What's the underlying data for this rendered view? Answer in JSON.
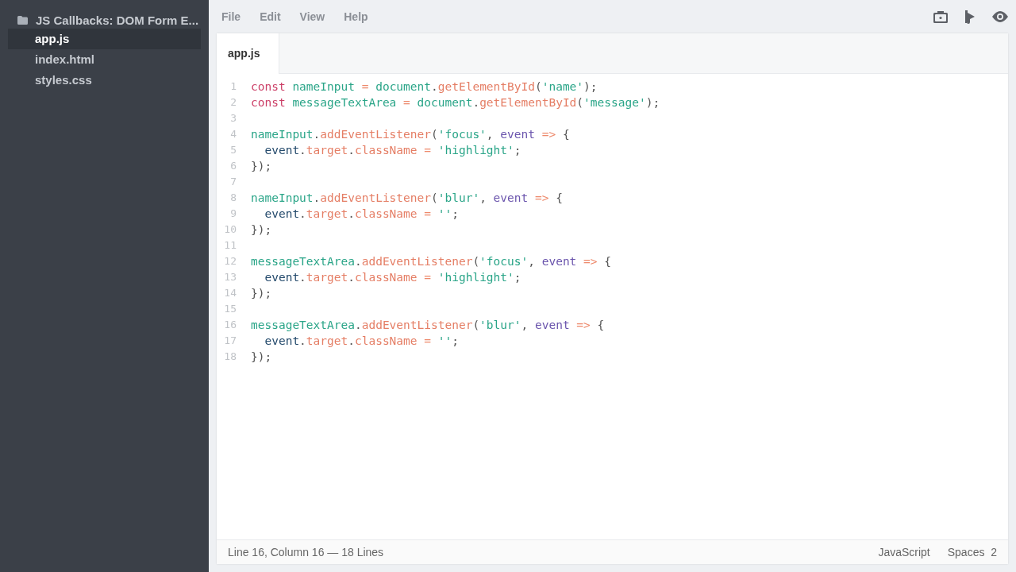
{
  "sidebar": {
    "project": "JS Callbacks: DOM Form E...",
    "files": [
      {
        "name": "app.js",
        "selected": true
      },
      {
        "name": "index.html",
        "selected": false
      },
      {
        "name": "styles.css",
        "selected": false
      }
    ]
  },
  "menu": [
    "File",
    "Edit",
    "View",
    "Help"
  ],
  "tabs": [
    {
      "label": "app.js",
      "selected": true
    }
  ],
  "code": [
    {
      "number": "1",
      "tokens": [
        {
          "kind": "kw",
          "text": "const "
        },
        {
          "kind": "var",
          "text": "nameInput "
        },
        {
          "kind": "op",
          "text": "= "
        },
        {
          "kind": "var",
          "text": "document"
        },
        {
          "kind": "p",
          "text": "."
        },
        {
          "kind": "fn",
          "text": "getElementById"
        },
        {
          "kind": "p",
          "text": "("
        },
        {
          "kind": "str",
          "text": "'name'"
        },
        {
          "kind": "p",
          "text": ");"
        }
      ]
    },
    {
      "number": "2",
      "tokens": [
        {
          "kind": "kw",
          "text": "const "
        },
        {
          "kind": "var",
          "text": "messageTextArea "
        },
        {
          "kind": "op",
          "text": "= "
        },
        {
          "kind": "var",
          "text": "document"
        },
        {
          "kind": "p",
          "text": "."
        },
        {
          "kind": "fn",
          "text": "getElementById"
        },
        {
          "kind": "p",
          "text": "("
        },
        {
          "kind": "str",
          "text": "'message'"
        },
        {
          "kind": "p",
          "text": ");"
        }
      ]
    },
    {
      "number": "3"
    },
    {
      "number": "4",
      "tokens": [
        {
          "kind": "var",
          "text": "nameInput"
        },
        {
          "kind": "p",
          "text": "."
        },
        {
          "kind": "fn",
          "text": "addEventListener"
        },
        {
          "kind": "p",
          "text": "("
        },
        {
          "kind": "str",
          "text": "'focus'"
        },
        {
          "kind": "p",
          "text": ", "
        },
        {
          "kind": "param",
          "text": "event "
        },
        {
          "kind": "op",
          "text": "=> "
        },
        {
          "kind": "p",
          "text": "{"
        }
      ]
    },
    {
      "number": "5",
      "tokens": [
        {
          "kind": "obj",
          "text": "  event"
        },
        {
          "kind": "p",
          "text": "."
        },
        {
          "kind": "fn",
          "text": "target"
        },
        {
          "kind": "p",
          "text": "."
        },
        {
          "kind": "fn",
          "text": "className "
        },
        {
          "kind": "op",
          "text": "= "
        },
        {
          "kind": "str",
          "text": "'highlight'"
        },
        {
          "kind": "p",
          "text": ";"
        }
      ]
    },
    {
      "number": "6",
      "tokens": [
        {
          "kind": "p",
          "text": "});"
        }
      ]
    },
    {
      "number": "7"
    },
    {
      "number": "8",
      "tokens": [
        {
          "kind": "var",
          "text": "nameInput"
        },
        {
          "kind": "p",
          "text": "."
        },
        {
          "kind": "fn",
          "text": "addEventListener"
        },
        {
          "kind": "p",
          "text": "("
        },
        {
          "kind": "str",
          "text": "'blur'"
        },
        {
          "kind": "p",
          "text": ", "
        },
        {
          "kind": "param",
          "text": "event "
        },
        {
          "kind": "op",
          "text": "=> "
        },
        {
          "kind": "p",
          "text": "{"
        }
      ]
    },
    {
      "number": "9",
      "tokens": [
        {
          "kind": "obj",
          "text": "  event"
        },
        {
          "kind": "p",
          "text": "."
        },
        {
          "kind": "fn",
          "text": "target"
        },
        {
          "kind": "p",
          "text": "."
        },
        {
          "kind": "fn",
          "text": "className "
        },
        {
          "kind": "op",
          "text": "= "
        },
        {
          "kind": "str",
          "text": "''"
        },
        {
          "kind": "p",
          "text": ";"
        }
      ]
    },
    {
      "number": "10",
      "tokens": [
        {
          "kind": "p",
          "text": "});"
        }
      ]
    },
    {
      "number": "11"
    },
    {
      "number": "12",
      "tokens": [
        {
          "kind": "var",
          "text": "messageTextArea"
        },
        {
          "kind": "p",
          "text": "."
        },
        {
          "kind": "fn",
          "text": "addEventListener"
        },
        {
          "kind": "p",
          "text": "("
        },
        {
          "kind": "str",
          "text": "'focus'"
        },
        {
          "kind": "p",
          "text": ", "
        },
        {
          "kind": "param",
          "text": "event "
        },
        {
          "kind": "op",
          "text": "=> "
        },
        {
          "kind": "p",
          "text": "{"
        }
      ]
    },
    {
      "number": "13",
      "tokens": [
        {
          "kind": "obj",
          "text": "  event"
        },
        {
          "kind": "p",
          "text": "."
        },
        {
          "kind": "fn",
          "text": "target"
        },
        {
          "kind": "p",
          "text": "."
        },
        {
          "kind": "fn",
          "text": "className "
        },
        {
          "kind": "op",
          "text": "= "
        },
        {
          "kind": "str",
          "text": "'highlight'"
        },
        {
          "kind": "p",
          "text": ";"
        }
      ]
    },
    {
      "number": "14",
      "tokens": [
        {
          "kind": "p",
          "text": "});"
        }
      ]
    },
    {
      "number": "15"
    },
    {
      "number": "16",
      "tokens": [
        {
          "kind": "var",
          "text": "messageTextArea"
        },
        {
          "kind": "p",
          "text": "."
        },
        {
          "kind": "fn",
          "text": "addEventListener"
        },
        {
          "kind": "p",
          "text": "("
        },
        {
          "kind": "str",
          "text": "'blur'"
        },
        {
          "kind": "p",
          "text": ", "
        },
        {
          "kind": "param",
          "text": "event "
        },
        {
          "kind": "op",
          "text": "=> "
        },
        {
          "kind": "p",
          "text": "{"
        }
      ]
    },
    {
      "number": "17",
      "tokens": [
        {
          "kind": "obj",
          "text": "  event"
        },
        {
          "kind": "p",
          "text": "."
        },
        {
          "kind": "fn",
          "text": "target"
        },
        {
          "kind": "p",
          "text": "."
        },
        {
          "kind": "fn",
          "text": "className "
        },
        {
          "kind": "op",
          "text": "= "
        },
        {
          "kind": "str",
          "text": "''"
        },
        {
          "kind": "p",
          "text": ";"
        }
      ]
    },
    {
      "number": "18",
      "tokens": [
        {
          "kind": "p",
          "text": "});"
        }
      ]
    }
  ],
  "status_bar": {
    "position": "Line 16, Column 16 — 18 Lines",
    "language": "JavaScript",
    "indent": "Spaces  2"
  }
}
